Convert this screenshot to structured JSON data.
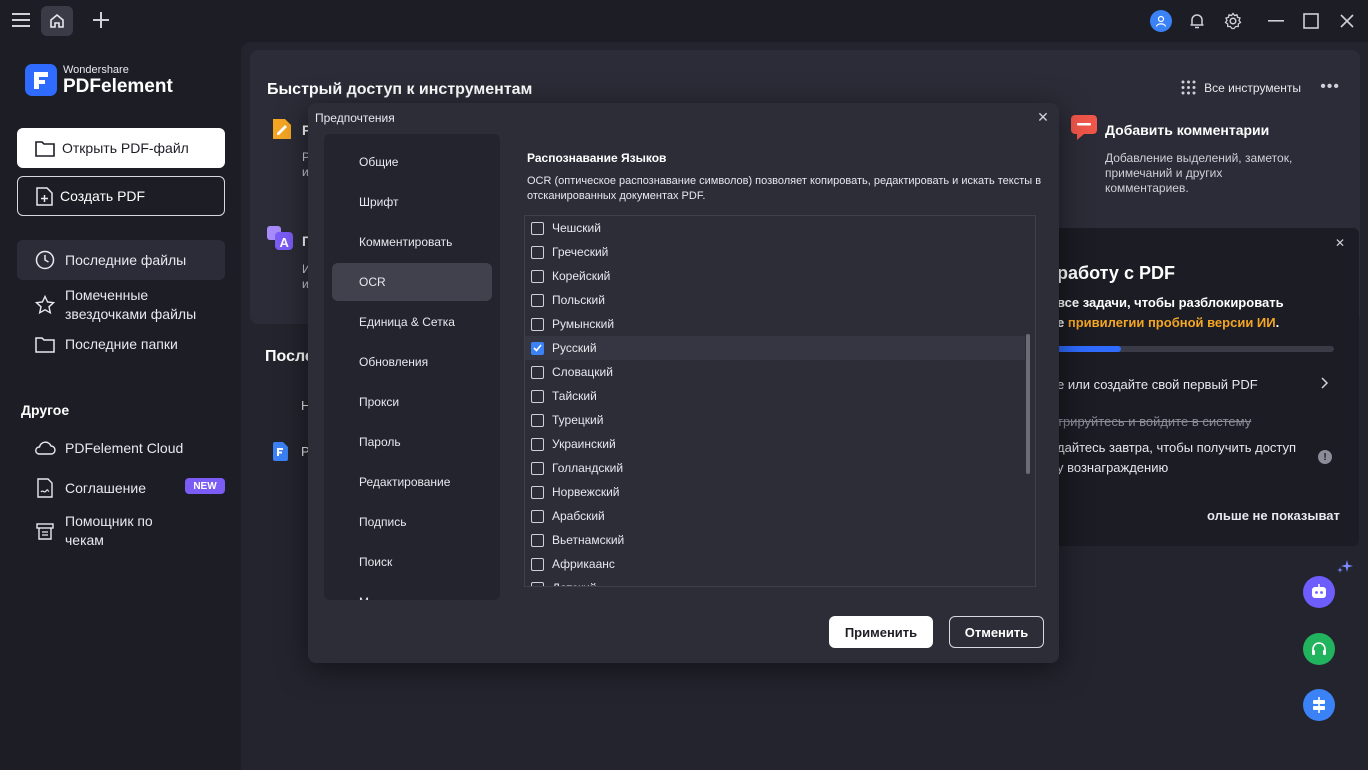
{
  "app": {
    "brand": "Wondershare",
    "name": "PDFelement"
  },
  "sidebar": {
    "open_pdf": "Открыть PDF-файл",
    "create_pdf": "Создать PDF",
    "items": [
      {
        "label": "Последние файлы"
      },
      {
        "label": "Помеченные звездочками файлы"
      },
      {
        "label": "Последние папки"
      }
    ],
    "other_label": "Другое",
    "other_items": [
      {
        "label": "PDFelement Cloud"
      },
      {
        "label": "Соглашение"
      },
      {
        "label": "Помощник по чекам"
      }
    ],
    "new_badge": "NEW"
  },
  "main": {
    "quick_access_title": "Быстрый доступ к инструментам",
    "all_tools": "Все инструменты",
    "more": "•••",
    "tools": [
      {
        "title": "Р",
        "desc": "Р\nи"
      },
      {
        "title": "П",
        "desc": "И\nи"
      },
      {
        "title": "Добавить комментарии",
        "desc": "Добавление выделений, заметок, примечаний и других комментариев."
      }
    ],
    "recent_title": "После",
    "recent_items": [
      {
        "label": "Н"
      },
      {
        "label": "Р"
      }
    ]
  },
  "promo": {
    "close": "✕",
    "title": "работу с PDF",
    "subtitle_a": "все задачи, чтобы разблокировать",
    "subtitle_b_prefix": "е",
    "subtitle_b_highlight": "привилегии пробной версии ИИ",
    "subtitle_b_suffix": ".",
    "progress": 0.23,
    "task1": "е или создайте свой первый PDF",
    "task2": "трируйтесь и войдите в систему",
    "task3a": "дайтесь завтра, чтобы получить доступ",
    "task3b": "у вознаграждению",
    "dont_show": "ольше не показыват"
  },
  "modal": {
    "title": "Предпочтения",
    "close": "✕",
    "nav": [
      {
        "label": "Общие"
      },
      {
        "label": "Шрифт"
      },
      {
        "label": "Комментировать"
      },
      {
        "label": "OCR"
      },
      {
        "label": "Единица & Сетка"
      },
      {
        "label": "Обновления"
      },
      {
        "label": "Прокси"
      },
      {
        "label": "Пароль"
      },
      {
        "label": "Редактирование"
      },
      {
        "label": "Подпись"
      },
      {
        "label": "Поиск"
      },
      {
        "label": "М"
      }
    ],
    "active_nav": "OCR",
    "ocr_title": "Распознавание Языков",
    "ocr_desc": "OCR (оптическое распознавание символов) позволяет копировать, редактировать и искать тексты в отсканированных документах PDF.",
    "languages": [
      {
        "label": "Чешский",
        "checked": false
      },
      {
        "label": "Греческий",
        "checked": false
      },
      {
        "label": "Корейский",
        "checked": false
      },
      {
        "label": "Польский",
        "checked": false
      },
      {
        "label": "Румынский",
        "checked": false
      },
      {
        "label": "Русский",
        "checked": true
      },
      {
        "label": "Словацкий",
        "checked": false
      },
      {
        "label": "Тайский",
        "checked": false
      },
      {
        "label": "Турецкий",
        "checked": false
      },
      {
        "label": "Украинский",
        "checked": false
      },
      {
        "label": "Голландский",
        "checked": false
      },
      {
        "label": "Норвежский",
        "checked": false
      },
      {
        "label": "Арабский",
        "checked": false
      },
      {
        "label": "Вьетнамский",
        "checked": false
      },
      {
        "label": "Африкаанс",
        "checked": false
      },
      {
        "label": "Датский",
        "checked": false
      }
    ],
    "apply": "Применить",
    "cancel": "Отменить"
  },
  "colors": {
    "accent": "#2f6bff",
    "highlight": "#f5a623",
    "checkbox": "#3b82f6",
    "new_badge": "#7b5cf5"
  }
}
